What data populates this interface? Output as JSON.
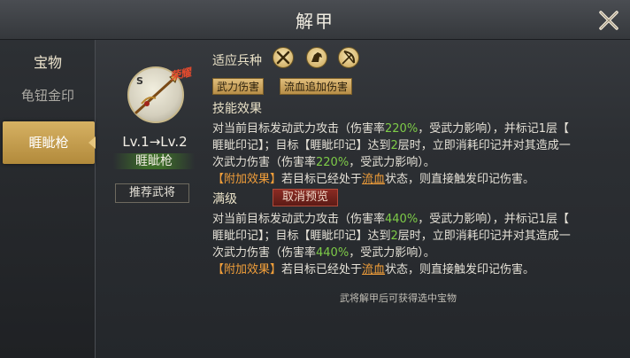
{
  "window": {
    "title": "解甲",
    "close_icon": "close-x-icon"
  },
  "sidebar": {
    "header": "宝物",
    "items": [
      {
        "label": "龟钮金印"
      },
      {
        "label": "睚眦枪"
      }
    ]
  },
  "weapon": {
    "grade": "S",
    "tag": "荣耀",
    "level": "Lv.1→Lv.2",
    "name": "睚眦枪",
    "recommend_button": "推荐武将"
  },
  "unit_types": {
    "label": "适应兵种",
    "icons": [
      "crossed-swords-icon",
      "horse-icon",
      "bow-icon"
    ]
  },
  "damage_tags": [
    "武力伤害",
    "流血追加伤害"
  ],
  "skill": {
    "label": "技能效果",
    "line1_a": "对当前目标发动武力攻击（伤害率",
    "line1_rate": "220%",
    "line1_b": "，受武力影响），并标记1层【",
    "line2_a": "睚眦印记】；目标【睚眦印记】达到",
    "line2_num": "2",
    "line2_b": "层时，立即消耗印记并对其造成一",
    "line3_a": "次武力伤害（伤害率",
    "line3_rate": "220%",
    "line3_b": "，受武力影响）。",
    "extra_tag": "【附加效果】",
    "extra_a": "若目标已经处于",
    "extra_link": "流血",
    "extra_b": "状态，则直接触发印记伤害。"
  },
  "max_level": {
    "label": "满级",
    "cancel_button": "取消预览",
    "line1_a": "对当前目标发动武力攻击（伤害率",
    "line1_rate": "440%",
    "line1_b": "，受武力影响），并标记1层【",
    "line2_a": "睚眦印记】；目标【睚眦印记】达到",
    "line2_num": "2",
    "line2_b": "层时，立即消耗印记并对其造成一",
    "line3_a": "次武力伤害（伤害率",
    "line3_rate": "440%",
    "line3_b": "，受武力影响）。",
    "extra_tag": "【附加效果】",
    "extra_a": "若目标已经处于",
    "extra_link": "流血",
    "extra_b": "状态，则直接触发印记伤害。"
  },
  "footer": "武将解甲后可获得选中宝物",
  "colors": {
    "accent_gold": "#d6b163",
    "green_value": "#7ecb48",
    "orange_value": "#f29f3a",
    "cancel_red": "#8a2b23"
  }
}
